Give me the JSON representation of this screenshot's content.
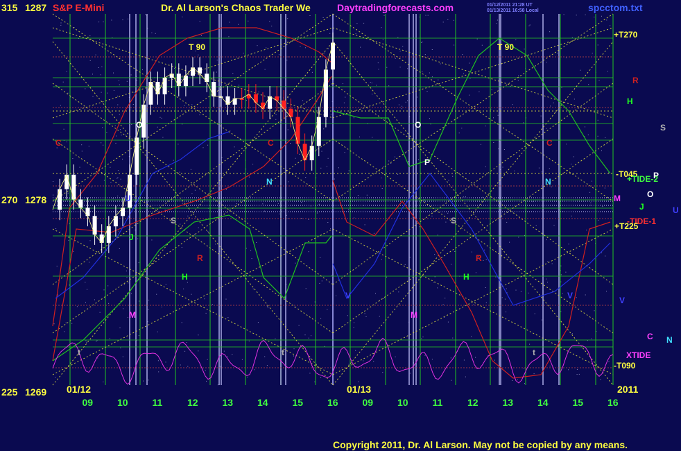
{
  "header": {
    "label_left": "315",
    "price_top": "1287",
    "symbol": "S&P E-Mini",
    "title": "Dr. Al Larson's Chaos Trader We",
    "site": "Daytradingforecasts.com",
    "timestamp_1": "01/12/2011 21:28 UT",
    "timestamp_2": "01/13/2011 16:58 Local",
    "filename": "spcctom.txt"
  },
  "y_axis": {
    "labels": [
      {
        "left": "315",
        "price": "1287"
      },
      {
        "left": "270",
        "price": "1278"
      },
      {
        "left": "225",
        "price": "1269"
      }
    ]
  },
  "x_axis": {
    "hour_ticks": [
      "09",
      "10",
      "11",
      "12",
      "13",
      "14",
      "15",
      "16",
      "09",
      "10",
      "11",
      "12",
      "13",
      "14",
      "15",
      "16"
    ],
    "dates": [
      "01/12",
      "01/13"
    ],
    "year": "2011"
  },
  "copyright": "Copyright 2011, Dr. Al Larson. May not be copied by any means.",
  "colors": {
    "background": "#0a0a50",
    "grid_green": "#22c522",
    "grid_yellow": "#d8d840",
    "red_line": "#d02020",
    "green_line": "#20c020",
    "magenta_line": "#e030e0",
    "blue_line": "#2030e0",
    "candle": "#ffffff",
    "candle_red": "#ff2020",
    "copyright": "#ffff40",
    "site": "#ff40ff"
  },
  "chart_data": {
    "type": "line",
    "title": "S&P E-Mini",
    "ylim": [
      1269,
      1287
    ],
    "y_ticks": [
      1269,
      1278,
      1287
    ],
    "angle_ticks": [
      225,
      270,
      315
    ],
    "x_ticks": [
      "09",
      "10",
      "11",
      "12",
      "13",
      "14",
      "15",
      "16",
      "09",
      "10",
      "11",
      "12",
      "13",
      "14",
      "15",
      "16"
    ],
    "dates": [
      "01/12",
      "01/13"
    ],
    "grid": true,
    "right_labels": [
      {
        "text": "+T270",
        "color": "#ffff40"
      },
      {
        "text": "R",
        "color": "#d02020"
      },
      {
        "text": "H",
        "color": "#20ff20"
      },
      {
        "text": "S",
        "color": "#b0b0b0"
      },
      {
        "text": "-T045",
        "color": "#ffff40"
      },
      {
        "text": "+TIDE-2",
        "color": "#40ff40"
      },
      {
        "text": "P",
        "color": "#ffffff"
      },
      {
        "text": "O",
        "color": "#ffffff"
      },
      {
        "text": "M",
        "color": "#ff40ff"
      },
      {
        "text": "J",
        "color": "#20ff20"
      },
      {
        "text": "U",
        "color": "#4040ff"
      },
      {
        "text": "-TIDE-1",
        "color": "#ff3030"
      },
      {
        "text": "+T225",
        "color": "#ffff40"
      },
      {
        "text": "V",
        "color": "#4040ff"
      },
      {
        "text": "C",
        "color": "#ff40ff"
      },
      {
        "text": "N",
        "color": "#40e0ff"
      },
      {
        "text": "XTIDE",
        "color": "#ff40ff"
      },
      {
        "text": "-T090",
        "color": "#ffff40"
      }
    ],
    "in_chart_labels": [
      {
        "text": "T 90",
        "color": "#ffff40"
      },
      {
        "text": "T 90",
        "color": "#ffff40"
      },
      {
        "text": "O",
        "color": "#ffffff"
      },
      {
        "text": "O",
        "color": "#ffffff"
      },
      {
        "text": "C",
        "color": "#d02020"
      },
      {
        "text": "C",
        "color": "#d02020"
      },
      {
        "text": "C",
        "color": "#d02020"
      },
      {
        "text": "N",
        "color": "#40e0ff"
      },
      {
        "text": "N",
        "color": "#40e0ff"
      },
      {
        "text": "S",
        "color": "#b0b0b0"
      },
      {
        "text": "S",
        "color": "#b0b0b0"
      },
      {
        "text": "P",
        "color": "#ffffff"
      },
      {
        "text": "R",
        "color": "#d02020"
      },
      {
        "text": "R",
        "color": "#d02020"
      },
      {
        "text": "H",
        "color": "#20ff20"
      },
      {
        "text": "H",
        "color": "#20ff20"
      },
      {
        "text": "M",
        "color": "#ff40ff"
      },
      {
        "text": "M",
        "color": "#ff40ff"
      },
      {
        "text": "t",
        "color": "#b0b0b0"
      },
      {
        "text": "t",
        "color": "#b0b0b0"
      },
      {
        "text": "t",
        "color": "#b0b0b0"
      },
      {
        "text": "J",
        "color": "#20ff20"
      },
      {
        "text": "U",
        "color": "#4040ff"
      },
      {
        "text": "V",
        "color": "#4040ff"
      },
      {
        "text": "V",
        "color": "#4040ff"
      }
    ],
    "price_series": {
      "name": "",
      "hours": [
        8.0,
        8.2,
        8.4,
        8.6,
        8.8,
        9.0,
        9.2,
        9.4,
        9.6,
        9.8,
        10.0,
        10.2,
        10.4,
        10.6,
        10.8,
        11.0,
        11.2,
        11.4,
        11.6,
        11.8,
        12.0,
        12.2,
        12.4,
        12.6,
        12.8,
        13.0,
        13.2,
        13.4,
        13.6,
        13.8,
        14.0,
        14.2,
        14.4,
        14.6,
        14.8,
        15.0,
        15.2,
        15.4,
        15.6,
        15.8,
        16.0
      ],
      "values": [
        1277.5,
        1278.5,
        1279.2,
        1278.0,
        1277.6,
        1277.2,
        1276.3,
        1275.9,
        1276.7,
        1277.2,
        1277.6,
        1279.2,
        1281.0,
        1282.6,
        1283.7,
        1283.1,
        1283.9,
        1284.1,
        1283.5,
        1284.0,
        1284.4,
        1284.1,
        1283.7,
        1283.0,
        1283.0,
        1282.6,
        1282.9,
        1282.9,
        1283.1,
        1282.7,
        1282.4,
        1283.0,
        1282.8,
        1282.4,
        1282.0,
        1280.7,
        1279.9,
        1280.6,
        1282.0,
        1284.3,
        1285.6
      ]
    }
  }
}
